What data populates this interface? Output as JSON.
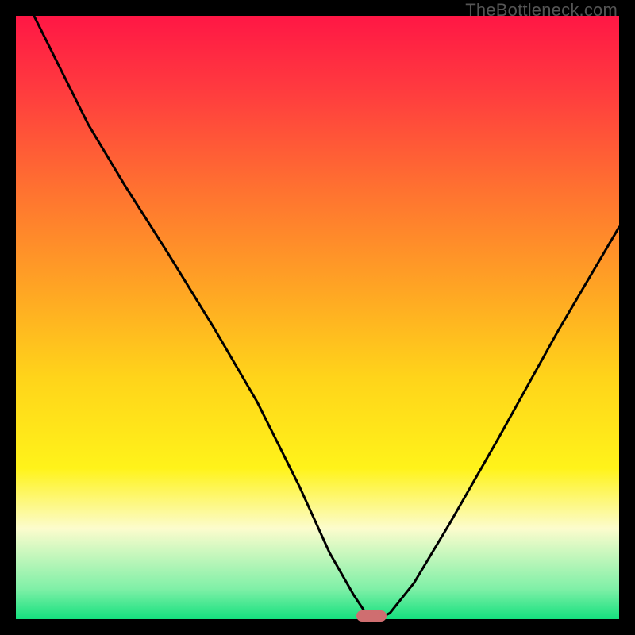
{
  "watermark": {
    "text": "TheBottleneck.com"
  },
  "chart_data": {
    "type": "line",
    "title": "",
    "xlabel": "",
    "ylabel": "",
    "xlim": [
      0,
      100
    ],
    "ylim": [
      0,
      100
    ],
    "grid": false,
    "legend": null,
    "gradient_stops": [
      {
        "pct": 0,
        "color": "#ff1745"
      },
      {
        "pct": 12,
        "color": "#ff3a3f"
      },
      {
        "pct": 28,
        "color": "#ff6f31"
      },
      {
        "pct": 45,
        "color": "#ffa424"
      },
      {
        "pct": 60,
        "color": "#ffd41a"
      },
      {
        "pct": 75,
        "color": "#fff31a"
      },
      {
        "pct": 85,
        "color": "#fcfccd"
      },
      {
        "pct": 95,
        "color": "#7ff0a7"
      },
      {
        "pct": 100,
        "color": "#14e07e"
      }
    ],
    "series": [
      {
        "name": "bottleneck-curve",
        "color": "#000000",
        "x": [
          3,
          7,
          12,
          18,
          25,
          33,
          40,
          47,
          52,
          56,
          58,
          60,
          62,
          66,
          72,
          80,
          90,
          100
        ],
        "y": [
          100,
          92,
          82,
          72,
          61,
          48,
          36,
          22,
          11,
          4,
          1,
          0,
          1,
          6,
          16,
          30,
          48,
          65
        ]
      }
    ],
    "marker": {
      "x": 59,
      "y": 0.5,
      "width_pct": 5.0,
      "height_pct": 1.8,
      "color": "#cf6e70"
    }
  }
}
